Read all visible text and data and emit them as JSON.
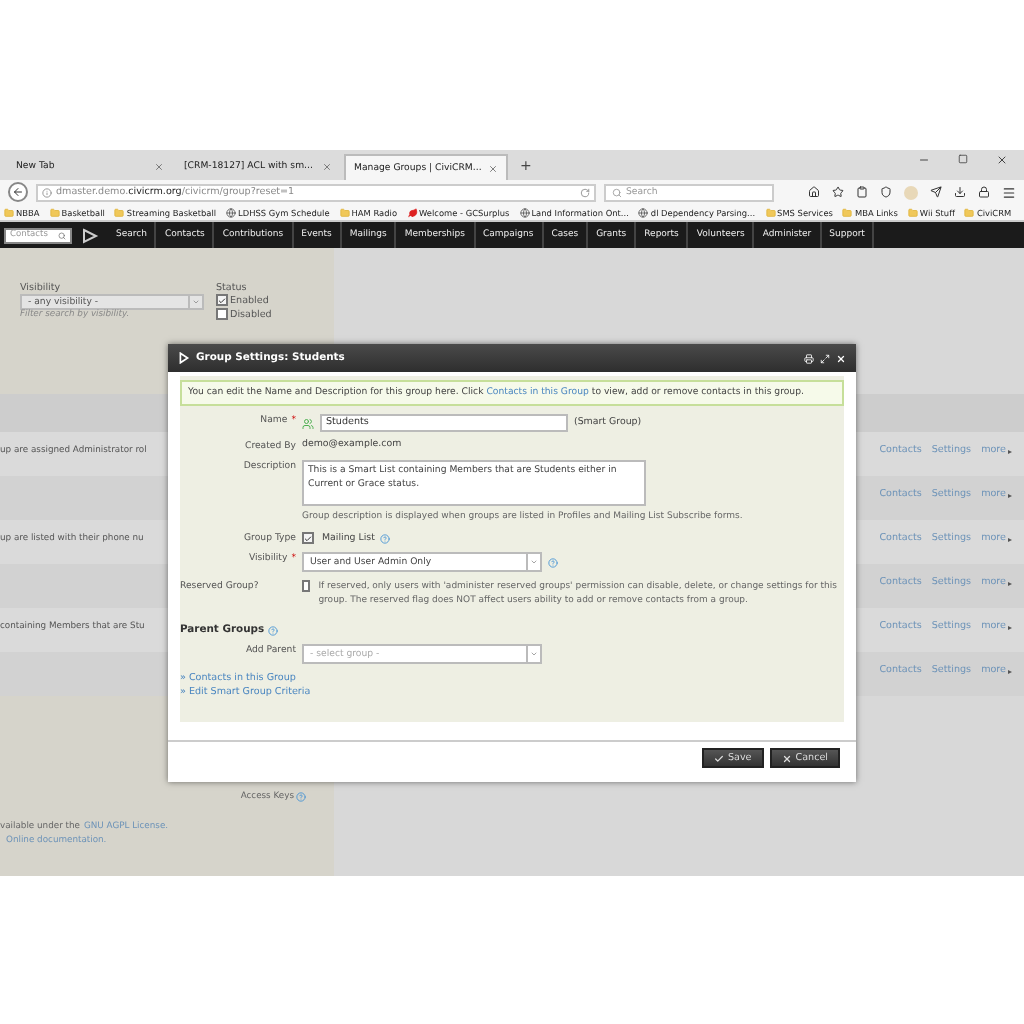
{
  "browser": {
    "tabs": [
      {
        "label": "New Tab",
        "selected": false
      },
      {
        "label": "[CRM-18127] ACL with sm...",
        "selected": false
      },
      {
        "label": "Manage Groups | CiviCRM...",
        "selected": true
      }
    ],
    "new_tab": "+",
    "address": "dmaster.demo.**civicrm.org**/civicrm/group?reset=1",
    "search_placeholder": "Search",
    "bookmarks": [
      {
        "label": "NBBA",
        "kind": "folder"
      },
      {
        "label": "Basketball",
        "kind": "folder"
      },
      {
        "label": "Streaming Basketball",
        "kind": "folder"
      },
      {
        "label": "LDHSS Gym Schedule",
        "kind": "site"
      },
      {
        "label": "HAM Radio",
        "kind": "folder"
      },
      {
        "label": "Welcome - GCSurplus",
        "kind": "leaf"
      },
      {
        "label": "Land Information Ont...",
        "kind": "site"
      },
      {
        "label": "dl Dependency Parsing...",
        "kind": "site"
      },
      {
        "label": "SMS Services",
        "kind": "folder"
      },
      {
        "label": "MBA Links",
        "kind": "folder"
      },
      {
        "label": "Wii Stuff",
        "kind": "folder"
      },
      {
        "label": "CiviCRM",
        "kind": "folder"
      }
    ]
  },
  "civicrm_menu": {
    "quicksearch_placeholder": "Contacts",
    "items": [
      "Search",
      "Contacts",
      "Contributions",
      "Events",
      "Mailings",
      "Memberships",
      "Campaigns",
      "Cases",
      "Grants",
      "Reports",
      "Volunteers",
      "Administer",
      "Support"
    ]
  },
  "filters": {
    "visibility": {
      "label": "Visibility",
      "value": "- any visibility -",
      "hint": "Filter search by visibility."
    },
    "status": {
      "label": "Status",
      "options": [
        {
          "label": "Enabled",
          "checked": true
        },
        {
          "label": "Disabled",
          "checked": false
        }
      ]
    }
  },
  "group_rows": [
    {
      "description": "up are assigned Administrator rol",
      "actions": [
        "Contacts",
        "Settings",
        "more"
      ]
    },
    {
      "actions": [
        "Contacts",
        "Settings",
        "more"
      ]
    },
    {
      "description": "up are listed with their phone nu",
      "actions": [
        "Contacts",
        "Settings",
        "more"
      ]
    },
    {
      "actions": [
        "Contacts",
        "Settings",
        "more"
      ]
    },
    {
      "description": "containing Members that are Stu",
      "actions": [
        "Contacts",
        "Settings",
        "more"
      ]
    },
    {
      "actions": [
        "Contacts",
        "Settings",
        "more"
      ]
    }
  ],
  "footer": {
    "access_keys": "Access Keys",
    "license_text": "vailable under the",
    "license_link": "GNU AGPL License.",
    "docs_link": "Online documentation."
  },
  "dialog": {
    "title": "Group Settings: Students",
    "help": {
      "before": "You can edit the Name and Description for this group here. Click",
      "link": "Contacts in this Group",
      "after": "to view, add or remove contacts in this group."
    },
    "fields": [
      {
        "kind": "name",
        "label": "Name",
        "marker": "*",
        "value": "Students",
        "note": "(Smart Group)"
      },
      {
        "kind": "static",
        "label": "Created By",
        "value": "demo@example.com"
      },
      {
        "kind": "textarea",
        "label": "Description",
        "value": "This is a Smart List containing Members that are Students either in Current or Grace status.",
        "hint": "Group description is displayed when groups are listed in Profiles and Mailing List Subscribe forms."
      },
      {
        "kind": "checkbox",
        "label": "Group Type",
        "option": "Mailing List",
        "checked": true,
        "help": true
      },
      {
        "kind": "select",
        "label": "Visibility",
        "marker": "*",
        "value": "User and User Admin Only",
        "help": true
      },
      {
        "kind": "reserved",
        "label": "Reserved Group?",
        "checked": false,
        "text": "If reserved, only users with 'administer reserved groups' permission can disable, delete, or change settings for this group. The reserved flag does NOT affect users ability to add or remove contacts from a group."
      }
    ],
    "parent_groups": {
      "heading": "Parent Groups",
      "help": true,
      "label": "Add Parent",
      "placeholder": "- select group -"
    },
    "links": [
      "» Contacts in this Group",
      "» Edit Smart Group Criteria"
    ],
    "buttons": [
      {
        "kind": "save",
        "label": "Save"
      },
      {
        "kind": "cancel",
        "label": "Cancel"
      }
    ]
  }
}
